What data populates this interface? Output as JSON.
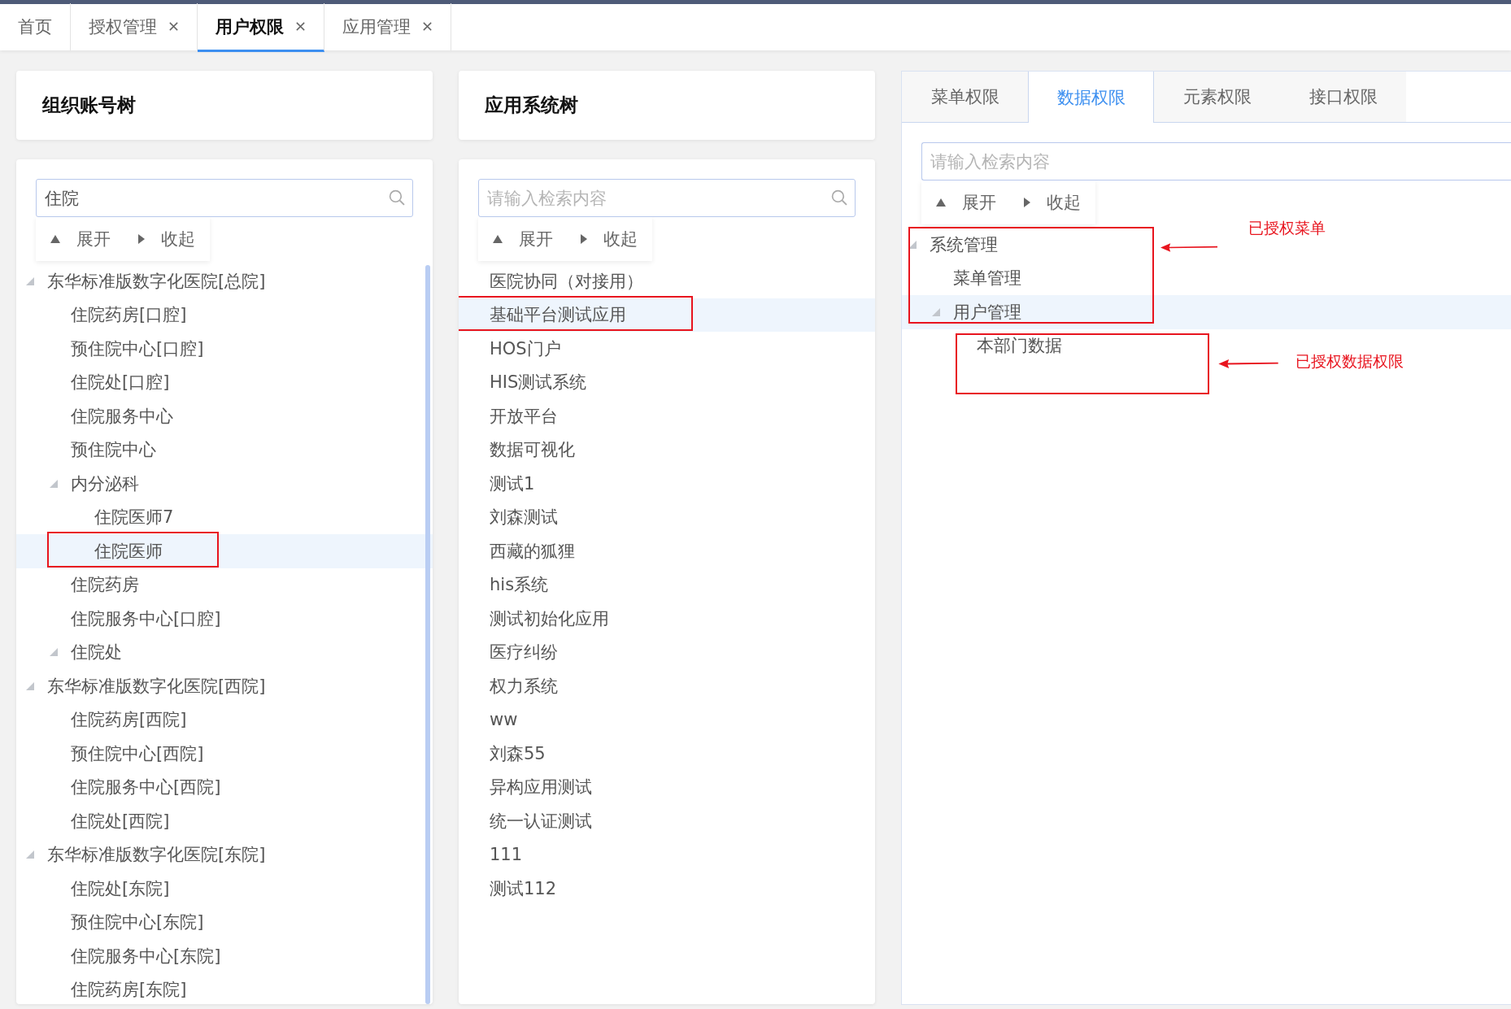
{
  "tabs": [
    {
      "label": "首页",
      "closable": false,
      "selected": false
    },
    {
      "label": "授权管理",
      "closable": true,
      "selected": false
    },
    {
      "label": "用户权限",
      "closable": true,
      "selected": true
    },
    {
      "label": "应用管理",
      "closable": true,
      "selected": false
    }
  ],
  "org_panel": {
    "title": "组织账号树",
    "search": {
      "value": "住院"
    },
    "toolbar": {
      "expand": "展开",
      "collapse": "收起"
    },
    "tree": [
      {
        "label": "东华标准版数字化医院[总院]",
        "expanded": true,
        "selected": false,
        "marked": false,
        "children": [
          {
            "label": "住院药房[口腔]",
            "expanded": false,
            "selected": false,
            "marked": false
          },
          {
            "label": "预住院中心[口腔]",
            "expanded": false,
            "selected": false,
            "marked": false
          },
          {
            "label": "住院处[口腔]",
            "expanded": false,
            "selected": false,
            "marked": false
          },
          {
            "label": "住院服务中心",
            "expanded": false,
            "selected": false,
            "marked": false
          },
          {
            "label": "预住院中心",
            "expanded": false,
            "selected": false,
            "marked": false
          },
          {
            "label": "内分泌科",
            "expanded": true,
            "selected": false,
            "marked": false,
            "children": [
              {
                "label": "住院医师7",
                "expanded": false,
                "selected": false,
                "marked": false
              },
              {
                "label": "住院医师",
                "expanded": false,
                "selected": true,
                "marked": true
              }
            ]
          },
          {
            "label": "住院药房",
            "expanded": false,
            "selected": false,
            "marked": false
          },
          {
            "label": "住院服务中心[口腔]",
            "expanded": false,
            "selected": false,
            "marked": false
          },
          {
            "label": "住院处",
            "expanded": true,
            "selected": false,
            "marked": false
          }
        ]
      },
      {
        "label": "东华标准版数字化医院[西院]",
        "expanded": true,
        "selected": false,
        "marked": false,
        "children": [
          {
            "label": "住院药房[西院]",
            "expanded": false,
            "selected": false,
            "marked": false
          },
          {
            "label": "预住院中心[西院]",
            "expanded": false,
            "selected": false,
            "marked": false
          },
          {
            "label": "住院服务中心[西院]",
            "expanded": false,
            "selected": false,
            "marked": false
          },
          {
            "label": "住院处[西院]",
            "expanded": false,
            "selected": false,
            "marked": false
          }
        ]
      },
      {
        "label": "东华标准版数字化医院[东院]",
        "expanded": true,
        "selected": false,
        "marked": false,
        "children": [
          {
            "label": "住院处[东院]",
            "expanded": false,
            "selected": false,
            "marked": false
          },
          {
            "label": "预住院中心[东院]",
            "expanded": false,
            "selected": false,
            "marked": false
          },
          {
            "label": "住院服务中心[东院]",
            "expanded": false,
            "selected": false,
            "marked": false
          },
          {
            "label": "住院药房[东院]",
            "expanded": false,
            "selected": false,
            "marked": false
          }
        ]
      }
    ]
  },
  "app_panel": {
    "title": "应用系统树",
    "search": {
      "placeholder": "请输入检索内容"
    },
    "toolbar": {
      "expand": "展开",
      "collapse": "收起"
    },
    "tree": [
      {
        "label": "医院协同（对接用）",
        "expanded": false,
        "selected": false,
        "marked": false
      },
      {
        "label": "基础平台测试应用",
        "expanded": false,
        "selected": true,
        "marked": true
      },
      {
        "label": "HOS门户",
        "expanded": false,
        "selected": false,
        "marked": false
      },
      {
        "label": "HIS测试系统",
        "expanded": false,
        "selected": false,
        "marked": false
      },
      {
        "label": "开放平台",
        "expanded": false,
        "selected": false,
        "marked": false
      },
      {
        "label": "数据可视化",
        "expanded": false,
        "selected": false,
        "marked": false
      },
      {
        "label": "测试1",
        "expanded": false,
        "selected": false,
        "marked": false
      },
      {
        "label": "刘森测试",
        "expanded": false,
        "selected": false,
        "marked": false
      },
      {
        "label": "西藏的狐狸",
        "expanded": false,
        "selected": false,
        "marked": false
      },
      {
        "label": "his系统",
        "expanded": false,
        "selected": false,
        "marked": false
      },
      {
        "label": "测试初始化应用",
        "expanded": false,
        "selected": false,
        "marked": false
      },
      {
        "label": "医疗纠纷",
        "expanded": false,
        "selected": false,
        "marked": false
      },
      {
        "label": "权力系统",
        "expanded": false,
        "selected": false,
        "marked": false
      },
      {
        "label": "ww",
        "expanded": false,
        "selected": false,
        "marked": false
      },
      {
        "label": "刘森55",
        "expanded": false,
        "selected": false,
        "marked": false
      },
      {
        "label": "异构应用测试",
        "expanded": false,
        "selected": false,
        "marked": false
      },
      {
        "label": "统一认证测试",
        "expanded": false,
        "selected": false,
        "marked": false
      },
      {
        "label": "111",
        "expanded": false,
        "selected": false,
        "marked": false
      },
      {
        "label": "测试112",
        "expanded": false,
        "selected": false,
        "marked": false
      }
    ]
  },
  "permission_panel": {
    "tabs": [
      {
        "label": "菜单权限",
        "selected": false
      },
      {
        "label": "数据权限",
        "selected": true
      },
      {
        "label": "元素权限",
        "selected": false
      },
      {
        "label": "接口权限",
        "selected": false
      }
    ],
    "search": {
      "placeholder": "请输入检索内容"
    },
    "toolbar": {
      "expand": "展开",
      "collapse": "收起"
    },
    "tree": [
      {
        "label": "系统管理",
        "expanded": true,
        "selected": false,
        "marked": false,
        "children": [
          {
            "label": "菜单管理",
            "expanded": false,
            "selected": false,
            "marked": false
          },
          {
            "label": "用户管理",
            "expanded": true,
            "selected": true,
            "marked": false,
            "children": [
              {
                "label": "本部门数据",
                "expanded": false,
                "selected": false,
                "marked": false
              }
            ]
          }
        ]
      }
    ]
  },
  "annotations": [
    {
      "text": "已授权菜单"
    },
    {
      "text": "已授权数据权限"
    }
  ]
}
